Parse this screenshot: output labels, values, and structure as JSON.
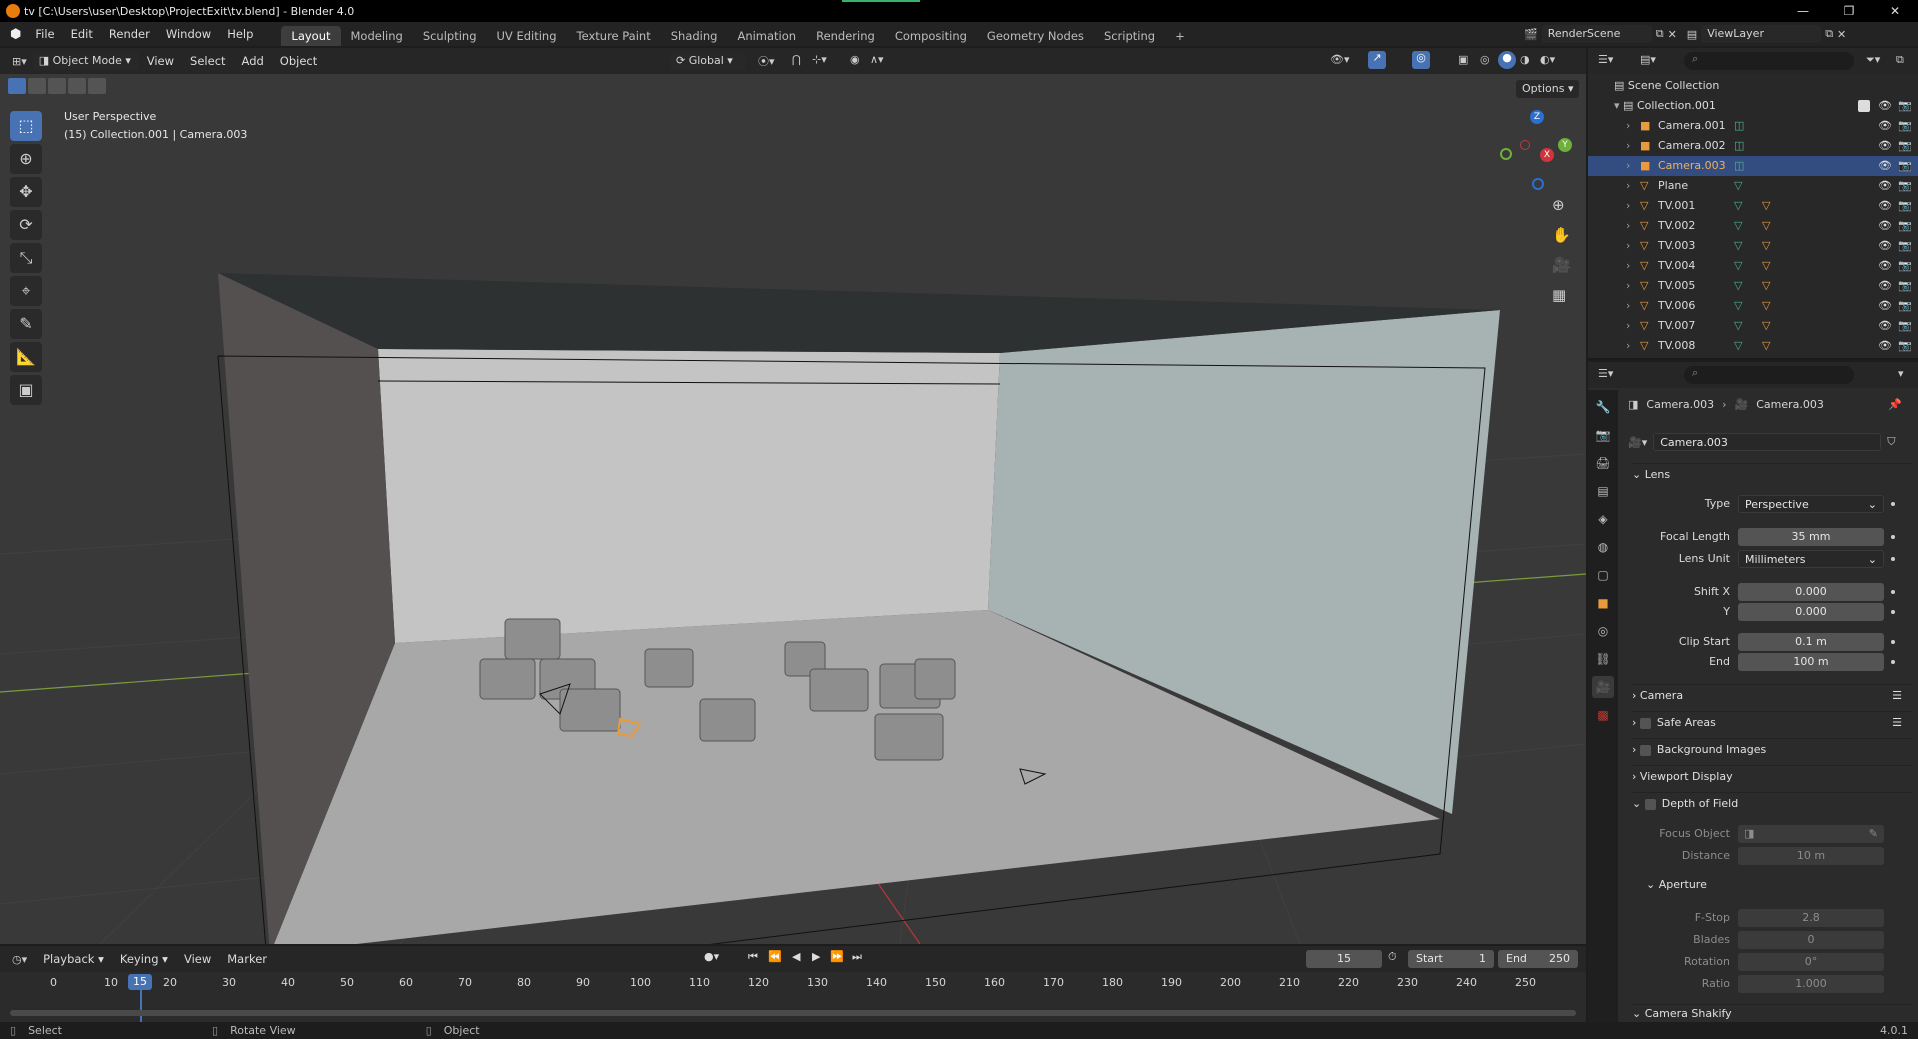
{
  "window": {
    "title": "tv [C:\\Users\\user\\Desktop\\ProjectExit\\tv.blend] - Blender 4.0",
    "minimize": "—",
    "restore": "❐",
    "close": "✕"
  },
  "menu": [
    "File",
    "Edit",
    "Render",
    "Window",
    "Help"
  ],
  "workspaces": [
    "Layout",
    "Modeling",
    "Sculpting",
    "UV Editing",
    "Texture Paint",
    "Shading",
    "Animation",
    "Rendering",
    "Compositing",
    "Geometry Nodes",
    "Scripting",
    "+"
  ],
  "scene": {
    "name": "RenderScene",
    "viewlayer": "ViewLayer"
  },
  "viewport_header": {
    "mode": "Object Mode",
    "menus": [
      "View",
      "Select",
      "Add",
      "Object"
    ],
    "orientation": "Global",
    "options": "Options"
  },
  "viewport": {
    "perspective": "User Perspective",
    "info": "(15) Collection.001 | Camera.003",
    "gizmo_axes": [
      "Z",
      "Y",
      "X"
    ]
  },
  "timeline": {
    "menus": [
      "Playback",
      "Keying",
      "View",
      "Marker"
    ],
    "current_frame": "15",
    "start_label": "Start",
    "start": "1",
    "end_label": "End",
    "end": "250",
    "ruler": [
      "0",
      "10",
      "20",
      "30",
      "40",
      "50",
      "60",
      "70",
      "80",
      "90",
      "100",
      "110",
      "120",
      "130",
      "140",
      "150",
      "160",
      "170",
      "180",
      "190",
      "200",
      "210",
      "220",
      "230",
      "240",
      "250"
    ],
    "ruler_cursor": "15"
  },
  "statusbar": {
    "left": "Select",
    "middle": "Rotate View",
    "right": "Object",
    "version": "4.0.1"
  },
  "outliner": {
    "root": "Scene Collection",
    "collection": "Collection.001",
    "items": [
      {
        "name": "Camera.001",
        "kind": "camera"
      },
      {
        "name": "Camera.002",
        "kind": "camera"
      },
      {
        "name": "Camera.003",
        "kind": "camera",
        "selected": true
      },
      {
        "name": "Plane",
        "kind": "mesh"
      },
      {
        "name": "TV.001",
        "kind": "mesh"
      },
      {
        "name": "TV.002",
        "kind": "mesh"
      },
      {
        "name": "TV.003",
        "kind": "mesh"
      },
      {
        "name": "TV.004",
        "kind": "mesh"
      },
      {
        "name": "TV.005",
        "kind": "mesh"
      },
      {
        "name": "TV.006",
        "kind": "mesh"
      },
      {
        "name": "TV.007",
        "kind": "mesh"
      },
      {
        "name": "TV.008",
        "kind": "mesh"
      }
    ]
  },
  "properties": {
    "breadcrumb_object": "Camera.003",
    "breadcrumb_data": "Camera.003",
    "datablock": "Camera.003",
    "lens_section": "Lens",
    "type_label": "Type",
    "type_value": "Perspective",
    "focal_label": "Focal Length",
    "focal_value": "35 mm",
    "lensunit_label": "Lens Unit",
    "lensunit_value": "Millimeters",
    "shiftx_label": "Shift X",
    "shiftx_value": "0.000",
    "shifty_label": "Y",
    "shifty_value": "0.000",
    "clipstart_label": "Clip Start",
    "clipstart_value": "0.1 m",
    "clipend_label": "End",
    "clipend_value": "100 m",
    "camera_section": "Camera",
    "safe_section": "Safe Areas",
    "bg_section": "Background Images",
    "vpdisplay_section": "Viewport Display",
    "dof_section": "Depth of Field",
    "focusobj_label": "Focus Object",
    "distance_label": "Distance",
    "distance_value": "10 m",
    "aperture_section": "Aperture",
    "fstop_label": "F-Stop",
    "fstop_value": "2.8",
    "blades_label": "Blades",
    "blades_value": "0",
    "rotation_label": "Rotation",
    "rotation_value": "0°",
    "ratio_label": "Ratio",
    "ratio_value": "1.000",
    "shakify_section": "Camera Shakify"
  },
  "colors": {
    "accent": "#4772b3",
    "selected_row": "#334d80",
    "orange": "#e99a3c",
    "camera_green": "#4eb28c"
  }
}
